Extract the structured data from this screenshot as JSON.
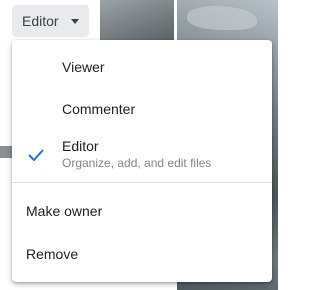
{
  "role_trigger": {
    "label": "Editor",
    "icon": "caret-down-icon"
  },
  "menu": {
    "roles": [
      {
        "label": "Viewer",
        "description": "",
        "selected": false
      },
      {
        "label": "Commenter",
        "description": "",
        "selected": false
      },
      {
        "label": "Editor",
        "description": "Organize, add, and edit files",
        "selected": true
      }
    ],
    "actions": [
      {
        "label": "Make owner"
      },
      {
        "label": "Remove"
      }
    ],
    "selected_icon": "check-icon"
  },
  "colors": {
    "check": "#1a73e8",
    "text": "#202124",
    "secondary_text": "#80868b",
    "trigger_bg": "#e8eaed"
  }
}
